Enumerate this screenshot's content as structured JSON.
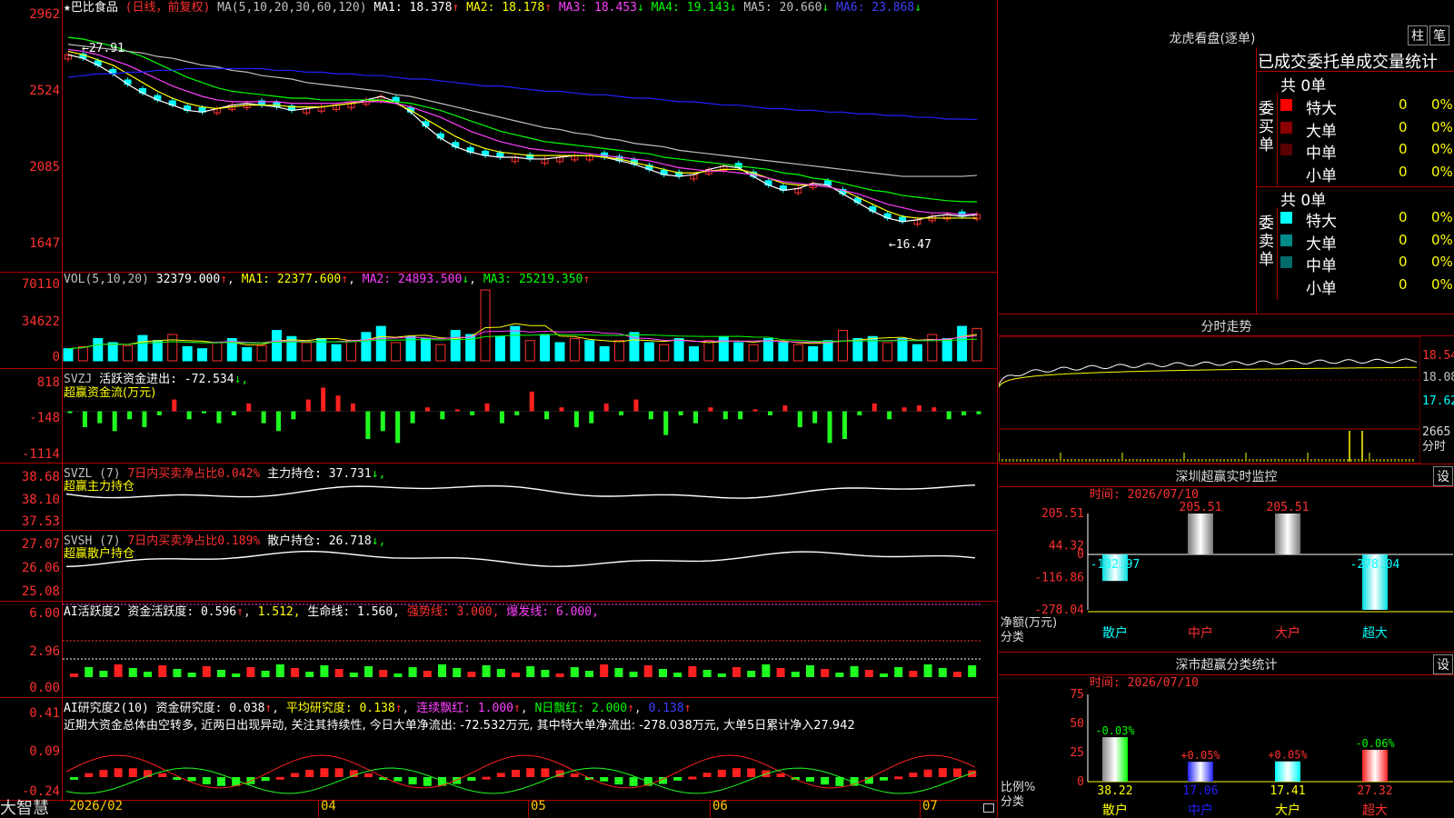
{
  "stock": {
    "name": "巴比食品",
    "mode": "(日线，前复权)",
    "ma_label": "MA(5,10,20,30,60,120)",
    "ma": [
      {
        "label": "MA1: 18.378",
        "arrow": "↑",
        "color": "#ffffff"
      },
      {
        "label": "MA2: 18.178",
        "arrow": "↑",
        "color": "#ffff00"
      },
      {
        "label": "MA3: 18.453",
        "arrow": "↓",
        "color": "#ff40ff"
      },
      {
        "label": "MA4: 19.143",
        "arrow": "↓",
        "color": "#00ff00"
      },
      {
        "label": "MA5: 20.660",
        "arrow": "↓",
        "color": "#c0c0c0"
      },
      {
        "label": "MA6: 23.868",
        "arrow": "↓",
        "color": "#4040ff"
      }
    ],
    "high_label": "27.91",
    "low_label": "16.47",
    "price_axis": [
      "2962",
      "2524",
      "2085",
      "1647"
    ]
  },
  "vol": {
    "title": "VOL(5,10,20)",
    "value": "32379.000",
    "ma1": "MA1: 22377.600",
    "ma2": "MA2: 24893.500",
    "ma3": "MA3: 25219.350",
    "axis": [
      "70110",
      "34622",
      "0"
    ]
  },
  "svzj": {
    "title": "SVZJ",
    "label": "活跃资金进出: -72.534",
    "arrow": "↓,",
    "subtitle": "超赢资金流(万元)",
    "axis": [
      "818",
      "-148",
      "-1114"
    ]
  },
  "svzl": {
    "title": "SVZL (7)",
    "ratio": "7日内买卖净占比0.042%",
    "label": "主力持仓: 37.731",
    "arrow": "↓,",
    "subtitle": "超赢主力持仓",
    "axis": [
      "38.68",
      "38.10",
      "37.53"
    ]
  },
  "svsh": {
    "title": "SVSH (7)",
    "ratio": "7日内买卖净占比0.189%",
    "label": "散户持仓: 26.718",
    "arrow": "↓,",
    "subtitle": "超赢散户持仓",
    "axis": [
      "27.07",
      "26.06",
      "25.08"
    ]
  },
  "ai_active": {
    "title": "AI活跃度2",
    "t1": "资金活跃度: 0.596",
    "t2": "1.512,",
    "t3": "生命线: 1.560,",
    "t4": "强势线: 3.000,",
    "t5": "爆发线: 6.000,",
    "axis": [
      "6.00",
      "2.96",
      "0.00"
    ]
  },
  "ai_research": {
    "title": "AI研究度2(10)",
    "t1": "资金研究度: 0.038",
    "t2": "平均研究度: 0.138",
    "t3": "连续飘红: 1.000",
    "t4": "N日飘红: 2.000",
    "t5": "0.138",
    "comment": "近期大资金总体由空转多, 近两日出现异动, 关注其持续性, 今日大单净流出: -72.532万元, 其中特大单净流出: -278.038万元, 大单5日累计净入27.942",
    "axis": [
      "0.41",
      "0.09",
      "-0.24"
    ]
  },
  "x_axis": [
    "2026/02",
    "04",
    "05",
    "06",
    "07"
  ],
  "brand": "大智慧",
  "lhb": {
    "title": "龙虎看盘(逐单)",
    "btn1": "柱",
    "btn2": "笔",
    "header": "已成交委托单成交量统计",
    "buy_label": "委买单",
    "sell_label": "委卖单",
    "buy_total": "共 0单",
    "sell_total": "共 0单",
    "rows_buy": [
      {
        "name": "特大",
        "count": "0",
        "pct": "0%",
        "color": "#ff0000"
      },
      {
        "name": "大单",
        "count": "0",
        "pct": "0%",
        "color": "#8b0000"
      },
      {
        "name": "中单",
        "count": "0",
        "pct": "0%",
        "color": "#5a0000"
      },
      {
        "name": "小单",
        "count": "0",
        "pct": "0%",
        "color": "#000000"
      }
    ],
    "rows_sell": [
      {
        "name": "特大",
        "count": "0",
        "pct": "0%",
        "color": "#00ffff"
      },
      {
        "name": "大单",
        "count": "0",
        "pct": "0%",
        "color": "#008b8b"
      },
      {
        "name": "中单",
        "count": "0",
        "pct": "0%",
        "color": "#006b6b"
      },
      {
        "name": "小单",
        "count": "0",
        "pct": "0%",
        "color": "#000000"
      }
    ]
  },
  "intraday": {
    "title": "分时走势",
    "axis": [
      "18.54",
      "18.08",
      "17.62"
    ],
    "vol_axis": "2665",
    "vol_label": "分时"
  },
  "sz_monitor": {
    "title": "深圳超赢实时监控",
    "btn": "设",
    "time": "时间: 2026/07/10",
    "axis": [
      "205.51",
      "44.32",
      "0",
      "-116.86",
      "-278.04"
    ],
    "ylabel": "净额(万元)",
    "xlabel": "分类",
    "categories": [
      "散户",
      "中户",
      "大户",
      "超大"
    ],
    "values": [
      -132.97,
      205.51,
      205.51,
      -278.04
    ],
    "value_labels": [
      "-132.97",
      "205.51",
      "205.51",
      "-278.04"
    ]
  },
  "sz_class": {
    "title": "深市超赢分类统计",
    "btn": "设",
    "time": "时间: 2026/07/10",
    "axis": [
      "75",
      "50",
      "25",
      "0"
    ],
    "ylabel": "比例%",
    "xlabel": "分类",
    "categories": [
      "散户",
      "中户",
      "大户",
      "超大"
    ],
    "values": [
      38.22,
      17.06,
      17.41,
      27.32
    ],
    "value_labels": [
      "38.22",
      "17.06",
      "17.41",
      "27.32"
    ],
    "changes": [
      "-0.03%",
      "+0.05%",
      "+0.05%",
      "-0.06%"
    ]
  },
  "chart_data": [
    {
      "type": "candlestick",
      "title": "巴比食品 (日线，前复权)",
      "ylim": [
        16.0,
        29.6
      ],
      "annotations": [
        "27.91",
        "16.47"
      ],
      "series": [
        {
          "name": "MA1",
          "values": [
            27.6,
            27.4,
            27.0,
            26.5,
            25.9,
            25.4,
            25.0,
            24.7,
            24.4,
            24.3,
            24.5,
            24.7,
            24.8,
            24.7,
            24.6,
            24.4,
            24.5,
            24.6,
            24.7,
            24.8,
            25.0,
            25.2,
            24.9,
            24.3,
            23.5,
            22.8,
            22.3,
            22.0,
            21.8,
            21.7,
            21.7,
            21.6,
            21.6,
            21.7,
            21.8,
            21.8,
            21.7,
            21.5,
            21.3,
            21.0,
            20.7,
            20.6,
            20.7,
            21.0,
            21.2,
            21.1,
            20.6,
            20.1,
            19.8,
            19.9,
            20.2,
            20.1,
            19.6,
            19.1,
            18.6,
            18.2,
            18.0,
            18.1,
            18.3,
            18.4,
            18.3,
            18.4
          ]
        },
        {
          "name": "MA2",
          "values": [
            27.8,
            27.6,
            27.3,
            27.0,
            26.5,
            26.0,
            25.5,
            25.1,
            24.8,
            24.6,
            24.5,
            24.6,
            24.7,
            24.7,
            24.7,
            24.6,
            24.6,
            24.6,
            24.7,
            24.8,
            24.9,
            25.0,
            24.8,
            24.4,
            23.9,
            23.4,
            22.9,
            22.5,
            22.2,
            22.0,
            21.9,
            21.8,
            21.8,
            21.8,
            21.8,
            21.8,
            21.7,
            21.6,
            21.4,
            21.2,
            21.0,
            20.8,
            20.8,
            20.9,
            21.0,
            21.0,
            20.8,
            20.5,
            20.2,
            20.1,
            20.1,
            20.0,
            19.8,
            19.4,
            19.0,
            18.6,
            18.3,
            18.2,
            18.2,
            18.2,
            18.2,
            18.2
          ]
        },
        {
          "name": "MA3",
          "values": [
            27.9,
            27.8,
            27.6,
            27.3,
            27.0,
            26.6,
            26.2,
            25.8,
            25.5,
            25.2,
            25.0,
            24.9,
            24.9,
            24.9,
            24.9,
            24.8,
            24.8,
            24.8,
            24.8,
            24.9,
            24.9,
            24.9,
            24.8,
            24.6,
            24.3,
            24.0,
            23.6,
            23.2,
            22.9,
            22.6,
            22.4,
            22.2,
            22.1,
            22.0,
            22.0,
            21.9,
            21.8,
            21.7,
            21.6,
            21.5,
            21.3,
            21.1,
            21.0,
            20.9,
            20.9,
            20.8,
            20.7,
            20.5,
            20.3,
            20.2,
            20.1,
            20.0,
            19.8,
            19.6,
            19.3,
            19.0,
            18.8,
            18.6,
            18.5,
            18.5,
            18.4,
            18.45
          ]
        },
        {
          "name": "MA4",
          "values": [
            28.6,
            28.5,
            28.3,
            28.1,
            27.8,
            27.5,
            27.1,
            26.7,
            26.3,
            26.0,
            25.7,
            25.5,
            25.4,
            25.3,
            25.2,
            25.1,
            25.1,
            25.0,
            25.0,
            25.0,
            25.0,
            25.0,
            24.9,
            24.8,
            24.6,
            24.4,
            24.1,
            23.8,
            23.5,
            23.2,
            23.0,
            22.8,
            22.6,
            22.5,
            22.4,
            22.3,
            22.2,
            22.1,
            22.0,
            21.9,
            21.7,
            21.6,
            21.5,
            21.4,
            21.3,
            21.2,
            21.1,
            21.0,
            20.8,
            20.7,
            20.5,
            20.4,
            20.2,
            20.0,
            19.8,
            19.7,
            19.5,
            19.4,
            19.3,
            19.2,
            19.15,
            19.14
          ]
        },
        {
          "name": "MA5",
          "values": [
            28.2,
            28.1,
            28.0,
            27.9,
            27.8,
            27.7,
            27.5,
            27.4,
            27.2,
            27.0,
            26.9,
            26.7,
            26.6,
            26.4,
            26.3,
            26.2,
            26.0,
            25.9,
            25.8,
            25.7,
            25.6,
            25.5,
            25.3,
            25.2,
            25.0,
            24.8,
            24.6,
            24.4,
            24.2,
            24.0,
            23.8,
            23.6,
            23.4,
            23.3,
            23.1,
            23.0,
            22.8,
            22.7,
            22.5,
            22.4,
            22.3,
            22.1,
            22.0,
            21.9,
            21.8,
            21.7,
            21.6,
            21.5,
            21.4,
            21.3,
            21.2,
            21.1,
            21.0,
            20.9,
            20.8,
            20.7,
            20.6,
            20.6,
            20.6,
            20.6,
            20.6,
            20.66
          ]
        },
        {
          "name": "MA6",
          "values": [
            26.3,
            26.4,
            26.5,
            26.5,
            26.6,
            26.6,
            26.7,
            26.7,
            26.8,
            26.8,
            26.8,
            26.8,
            26.8,
            26.8,
            26.7,
            26.7,
            26.6,
            26.6,
            26.5,
            26.5,
            26.4,
            26.4,
            26.3,
            26.2,
            26.2,
            26.1,
            26.0,
            25.9,
            25.8,
            25.8,
            25.7,
            25.6,
            25.5,
            25.5,
            25.4,
            25.3,
            25.3,
            25.2,
            25.1,
            25.1,
            25.0,
            24.9,
            24.9,
            24.8,
            24.7,
            24.7,
            24.6,
            24.5,
            24.5,
            24.4,
            24.4,
            24.3,
            24.3,
            24.2,
            24.2,
            24.1,
            24.1,
            24.0,
            24.0,
            23.9,
            23.9,
            23.87
          ]
        }
      ]
    },
    {
      "type": "bar",
      "title": "VOL(5,10,20)",
      "ylim": [
        0,
        70110
      ],
      "values": [
        12,
        14,
        22,
        18,
        15,
        25,
        20,
        26,
        14,
        12,
        18,
        22,
        13,
        15,
        30,
        24,
        18,
        22,
        16,
        20,
        28,
        34,
        18,
        24,
        22,
        16,
        30,
        26,
        70,
        24,
        34,
        20,
        26,
        18,
        22,
        20,
        14,
        20,
        28,
        18,
        16,
        22,
        14,
        20,
        24,
        18,
        16,
        22,
        18,
        16,
        14,
        20,
        30,
        22,
        24,
        18,
        22,
        16,
        26,
        22,
        34,
        32
      ]
    },
    {
      "type": "bar",
      "title": "超赢资金流(万元)",
      "ylim": [
        -1114,
        818
      ],
      "values": [
        -30,
        -400,
        -300,
        -500,
        -200,
        -400,
        -100,
        300,
        -200,
        -50,
        -300,
        -100,
        200,
        -300,
        -500,
        -200,
        300,
        600,
        400,
        200,
        -700,
        -500,
        -800,
        -300,
        100,
        -200,
        50,
        -100,
        200,
        -300,
        -100,
        500,
        -200,
        100,
        -400,
        -300,
        200,
        -100,
        300,
        -200,
        -600,
        -100,
        -300,
        100,
        -200,
        -200,
        50,
        -100,
        150,
        -400,
        -300,
        -800,
        -700,
        -100,
        200,
        -200,
        100,
        150,
        100,
        -200,
        -100,
        -72.5
      ]
    },
    {
      "type": "bar",
      "title": "深圳超赢实时监控",
      "categories": [
        "散户",
        "中户",
        "大户",
        "超大"
      ],
      "values": [
        -132.97,
        205.51,
        205.51,
        -278.04
      ],
      "ylim": [
        -278.04,
        205.51
      ],
      "ylabel": "净额(万元)",
      "xlabel": "分类"
    },
    {
      "type": "bar",
      "title": "深市超赢分类统计",
      "categories": [
        "散户",
        "中户",
        "大户",
        "超大"
      ],
      "values": [
        38.22,
        17.06,
        17.41,
        27.32
      ],
      "ylim": [
        0,
        75
      ],
      "ylabel": "比例%",
      "xlabel": "分类"
    }
  ]
}
